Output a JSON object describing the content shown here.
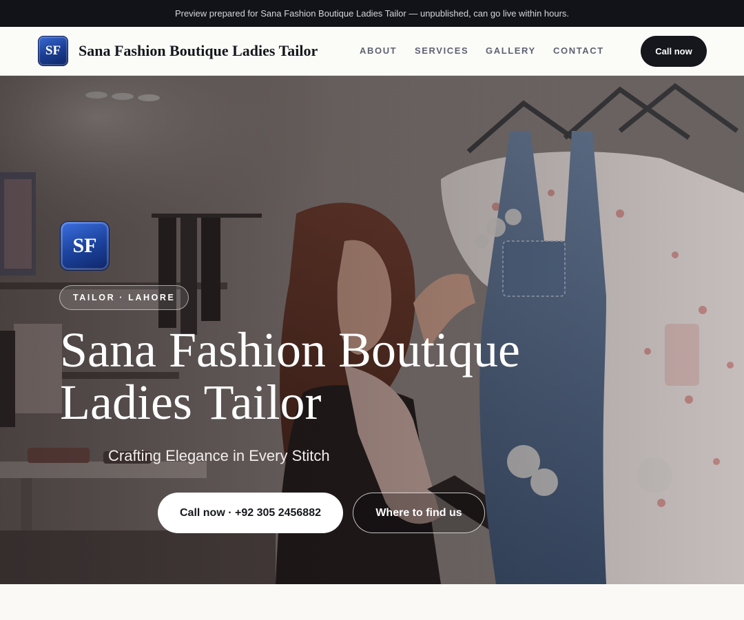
{
  "preview_banner": {
    "text": "Preview prepared for Sana Fashion Boutique Ladies Tailor — unpublished, can go live within hours."
  },
  "header": {
    "logo_initials": "SF",
    "brand_name": "Sana Fashion Boutique Ladies Tailor",
    "nav": {
      "about": "ABOUT",
      "services": "SERVICES",
      "gallery": "GALLERY",
      "contact": "CONTACT"
    },
    "cta_label": "Call now"
  },
  "hero": {
    "logo_initials": "SF",
    "category_pill": "TAILOR · LAHORE",
    "title_line1": "Sana Fashion Boutique",
    "title_line2": "Ladies Tailor",
    "tagline": "Crafting Elegance in Every Stitch",
    "primary_button": "Call now · +92 305 2456882",
    "secondary_button": "Where to find us"
  },
  "colors": {
    "topbar_bg": "#111318",
    "logo_blue": "#1d44a0",
    "dark_button": "#15171c"
  }
}
